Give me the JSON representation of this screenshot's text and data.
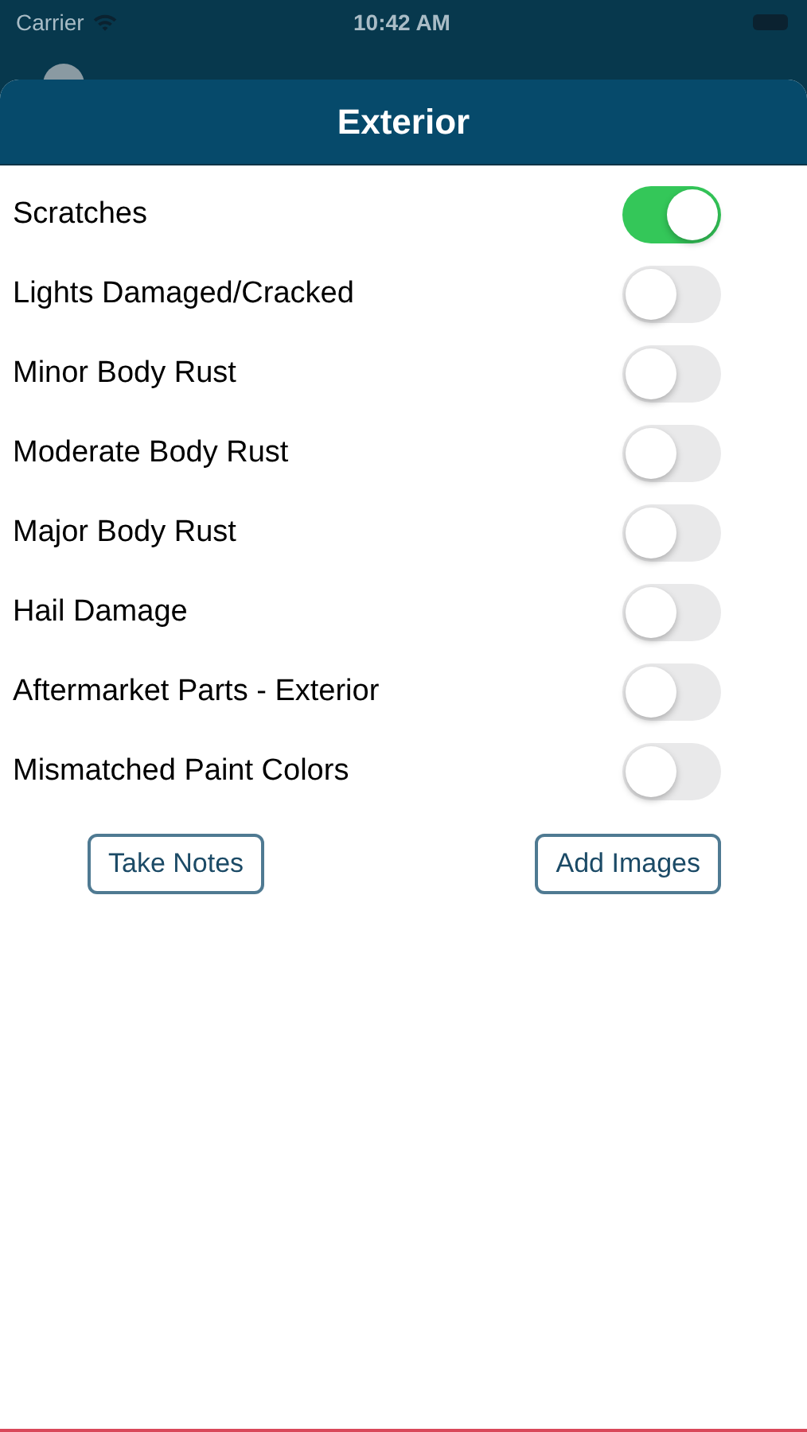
{
  "status_bar": {
    "carrier": "Carrier",
    "time": "10:42 AM"
  },
  "sheet": {
    "title": "Exterior"
  },
  "options": [
    {
      "label": "Scratches",
      "on": true
    },
    {
      "label": "Lights Damaged/Cracked",
      "on": false
    },
    {
      "label": "Minor Body Rust",
      "on": false
    },
    {
      "label": "Moderate Body Rust",
      "on": false
    },
    {
      "label": "Major Body Rust",
      "on": false
    },
    {
      "label": "Hail Damage",
      "on": false
    },
    {
      "label": "Aftermarket Parts - Exterior",
      "on": false
    },
    {
      "label": "Mismatched Paint Colors",
      "on": false
    }
  ],
  "buttons": [
    {
      "label": "Take Notes"
    },
    {
      "label": "Add Images"
    }
  ]
}
